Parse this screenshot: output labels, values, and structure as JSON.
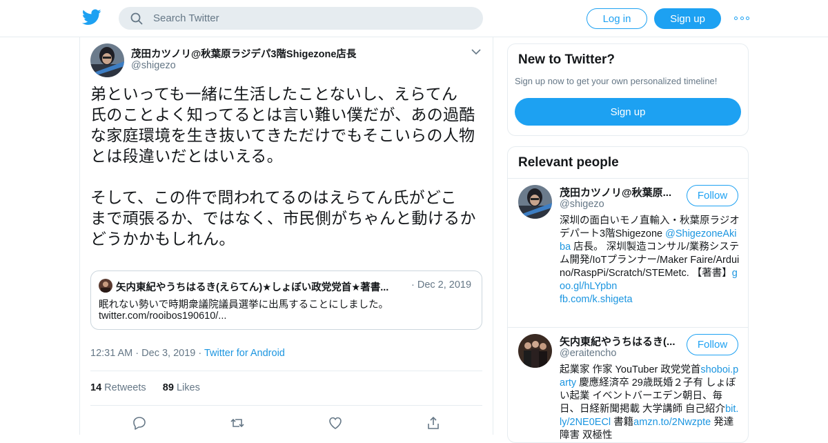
{
  "header": {
    "search_placeholder": "Search Twitter",
    "login_label": "Log in",
    "signup_label": "Sign up"
  },
  "tweet": {
    "author_name": "茂田カツノリ@秋葉原ラジデパ3階Shigezone店長",
    "author_handle": "@shigezo",
    "text": "弟といっても一緒に生活したことないし、えらてん\n氏のことよく知ってるとは言い難い僕だが、あの過酷\nな家庭環境を生き抜いてきただけでもそこいらの人物\nとは段違いだとはいえる。\n\nそして、この件で問われてるのはえらてん氏がどこ\nまで頑張るか、ではなく、市民側がちゃんと動けるか\nどうかかもしれん。",
    "quote": {
      "name": "矢内東紀やうちはるき(えらてん)★しょぼい政党党首★著書...",
      "date": "· Dec 2, 2019",
      "text": "眠れない勢いで時期衆議院議員選挙に出馬することにしました。",
      "link": "twitter.com/rooibos190610/..."
    },
    "time": "12:31 AM",
    "date": "Dec 3, 2019",
    "source": "Twitter for Android",
    "retweets_count": "14",
    "retweets_label": "Retweets",
    "likes_count": "89",
    "likes_label": "Likes"
  },
  "sidebar": {
    "new_title": "New to Twitter?",
    "new_sub": "Sign up now to get your own personalized timeline!",
    "new_signup": "Sign up",
    "people_title": "Relevant people",
    "people": [
      {
        "name": "茂田カツノリ@秋葉原...",
        "handle": "@shigezo",
        "follow": "Follow",
        "bio_1": "深圳の面白いモノ直輸入・秋葉原ラジオデパート3階Shigezone ",
        "bio_link_1": "@ShigezoneAkiba",
        "bio_2": " 店長。 深圳製造コンサル/業務システム開発/IoTプランナー/Maker Faire/Arduino/RaspPi/Scratch/STEMetc. 【著書】",
        "bio_link_2": "goo.gl/hLYpbn",
        "bio_link_3": "fb.com/k.shigeta"
      },
      {
        "name": "矢内東紀やうちはるき(...",
        "handle": "@eraitencho",
        "follow": "Follow",
        "bio_1": "起業家 作家 YouTuber 政党党首",
        "bio_link_1": "shoboi.party",
        "bio_2": " 慶應経済卒 29歳既婚２子有 しょぼい起業 イベントバーエデン朝日、毎日、日経新聞掲載 大学講師 自己紹介",
        "bio_link_2": "bit.ly/2NE0ECl",
        "bio_3": " 書籍",
        "bio_link_3": "amzn.to/2Nwzpte",
        "bio_4": " 発達障害 双極性"
      }
    ]
  },
  "colors": {
    "accent": "#1da1f2",
    "link": "#1b95e0",
    "muted": "#657786",
    "border": "#e6ecf0"
  }
}
